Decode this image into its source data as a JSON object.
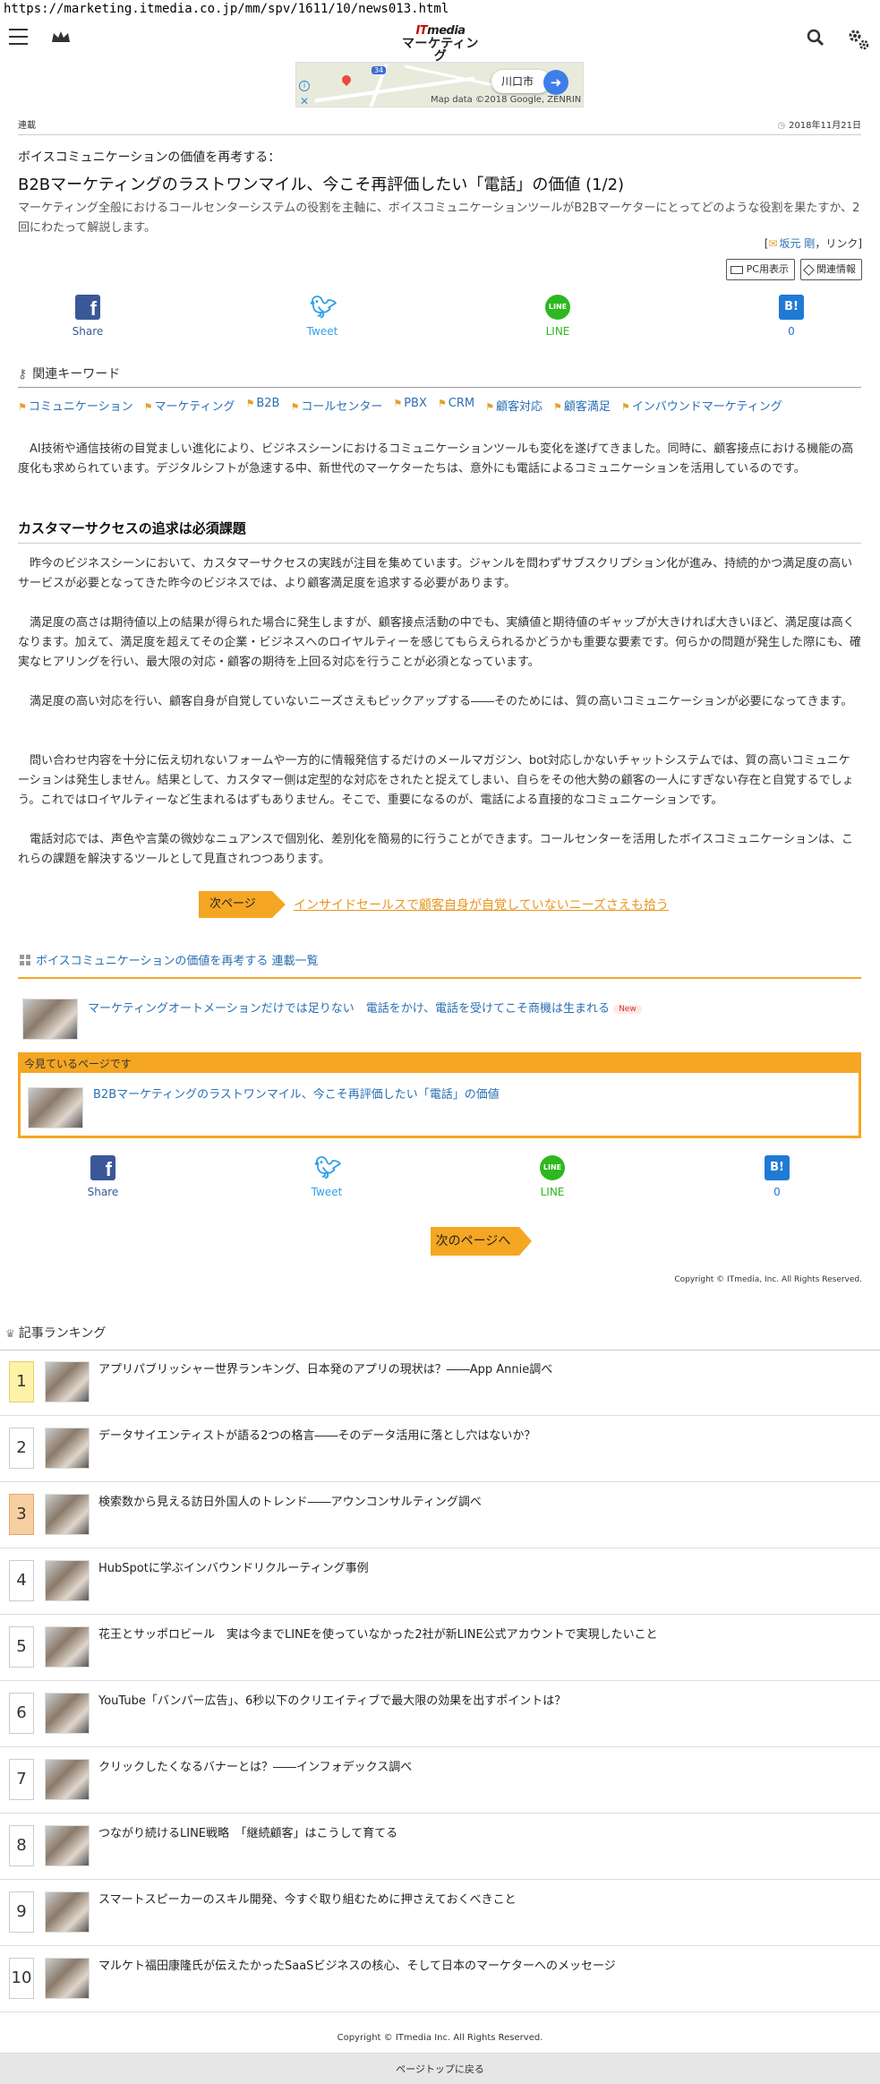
{
  "url": "https://marketing.itmedia.co.jp/mm/spv/1611/10/news013.html",
  "logo": {
    "line1_it": "IT",
    "line1_rest": "media",
    "line2": "マーケティング"
  },
  "ad": {
    "city": "川口市",
    "map_data": "Map data ©2018 Google, ZENRIN",
    "route": "34"
  },
  "meta": {
    "category": "連載",
    "date": "2018年11月21日"
  },
  "article": {
    "series_title": "ボイスコミュニケーションの価値を再考する：",
    "headline": "B2Bマーケティングのラストワンマイル、今こそ再評価したい「電話」の価値 (1/2)",
    "lead": "マーケティング全般におけるコールセンターシステムの役割を主軸に、ボイスコミュニケーションツールがB2Bマーケターにとってどのような役割を果たすか、2回にわたって解説します。",
    "authors_prefix": "[",
    "author_name": "坂元 剛",
    "authors_suffix": "，リンク]"
  },
  "buttons": {
    "pc": "PC用表示",
    "related": "関連情報"
  },
  "share": {
    "facebook": "Share",
    "twitter": "Tweet",
    "line": "LINE",
    "hatena": "0"
  },
  "keywords": {
    "title": "関連キーワード",
    "items": [
      "コミュニケーション",
      "マーケティング",
      "B2B",
      "コールセンター",
      "PBX",
      "CRM",
      "顧客対応",
      "顧客満足",
      "インバウンドマーケティング"
    ]
  },
  "body": {
    "p1": "AI技術や通信技術の目覚ましい進化により、ビジネスシーンにおけるコミュニケーションツールも変化を遂げてきました。同時に、顧客接点における機能の高度化も求められています。デジタルシフトが急速する中、新世代のマーケターたちは、意外にも電話によるコミュニケーションを活用しているのです。",
    "section": "カスタマーサクセスの追求は必須課題",
    "p2": "昨今のビジネスシーンにおいて、カスタマーサクセスの実践が注目を集めています。ジャンルを問わずサブスクリプション化が進み、持続的かつ満足度の高いサービスが必要となってきた昨今のビジネスでは、より顧客満足度を追求する必要があります。",
    "p3": "満足度の高さは期待値以上の結果が得られた場合に発生しますが、顧客接点活動の中でも、実績値と期待値のギャップが大きければ大きいほど、満足度は高くなります。加えて、満足度を超えてその企業・ビジネスへのロイヤルティーを感じてもらえられるかどうかも重要な要素です。何らかの問題が発生した際にも、確実なヒアリングを行い、最大限の対応・顧客の期待を上回る対応を行うことが必須となっています。",
    "p4": "満足度の高い対応を行い、顧客自身が自覚していないニーズさえもピックアップする――そのためには、質の高いコミュニケーションが必要になってきます。",
    "p5": "問い合わせ内容を十分に伝え切れないフォームや一方的に情報発信するだけのメールマガジン、bot対応しかないチャットシステムでは、質の高いコミュニケーションは発生しません。結果として、カスタマー側は定型的な対応をされたと捉えてしまい、自らをその他大勢の顧客の一人にすぎない存在と自覚するでしょう。これではロイヤルティーなど生まれるはずもありません。そこで、重要になるのが、電話による直接的なコミュニケーションです。",
    "p6": "電話対応では、声色や言葉の微妙なニュアンスで個別化、差別化を簡易的に行うことができます。コールセンターを活用したボイスコミュニケーションは、これらの課題を解決するツールとして見直されつつあります。"
  },
  "next_page": {
    "tag": "次ページ",
    "link": "インサイドセールスで顧客自身が自覚していないニーズさえも拾う"
  },
  "series_list": {
    "title": "ボイスコミュニケーションの価値を再考する 連載一覧",
    "item1": "マーケティングオートメーションだけでは足りない　電話をかけ、電話を受けてこそ商機は生まれる",
    "new_badge": "New",
    "current_label": "今見ているページです",
    "current_title": "B2Bマーケティングのラストワンマイル、今こそ再評価したい「電話」の価値"
  },
  "next_button": "次のページへ",
  "copyright1": "Copyright © ITmedia, Inc. All Rights Reserved.",
  "ranking": {
    "title": "記事ランキング",
    "items": [
      {
        "num": "1",
        "title": "アプリパブリッシャー世界ランキング、日本発のアプリの現状は？――App Annie調べ"
      },
      {
        "num": "2",
        "title": "データサイエンティストが語る2つの格言――そのデータ活用に落とし穴はないか？"
      },
      {
        "num": "3",
        "title": "検索数から見える訪日外国人のトレンド――アウンコンサルティング調べ"
      },
      {
        "num": "4",
        "title": "HubSpotに学ぶインバウンドリクルーティング事例"
      },
      {
        "num": "5",
        "title": "花王とサッポロビール　実は今までLINEを使っていなかった2社が新LINE公式アカウントで実現したいこと"
      },
      {
        "num": "6",
        "title": "YouTube「バンパー広告」、6秒以下のクリエイティブで最大限の効果を出すポイントは？"
      },
      {
        "num": "7",
        "title": "クリックしたくなるバナーとは？――インフォデックス調べ"
      },
      {
        "num": "8",
        "title": "つながり続けるLINE戦略　「継続顧客」はこうして育てる"
      },
      {
        "num": "9",
        "title": "スマートスピーカーのスキル開発、今すぐ取り組むために押さえておくべきこと"
      },
      {
        "num": "10",
        "title": "マルケト福田康隆氏が伝えたかったSaaSビジネスの核心、そして日本のマーケターへのメッセージ"
      }
    ]
  },
  "copyright2": "Copyright © ITmedia Inc. All Rights Reserved.",
  "page_top": "ページトップに戻る",
  "colors": {
    "accent": "#f5a623",
    "link": "#2a6fb4",
    "facebook": "#3a5898",
    "twitter": "#2fa0e8",
    "line": "#2cb81e",
    "hatena": "#1f7ad6"
  }
}
